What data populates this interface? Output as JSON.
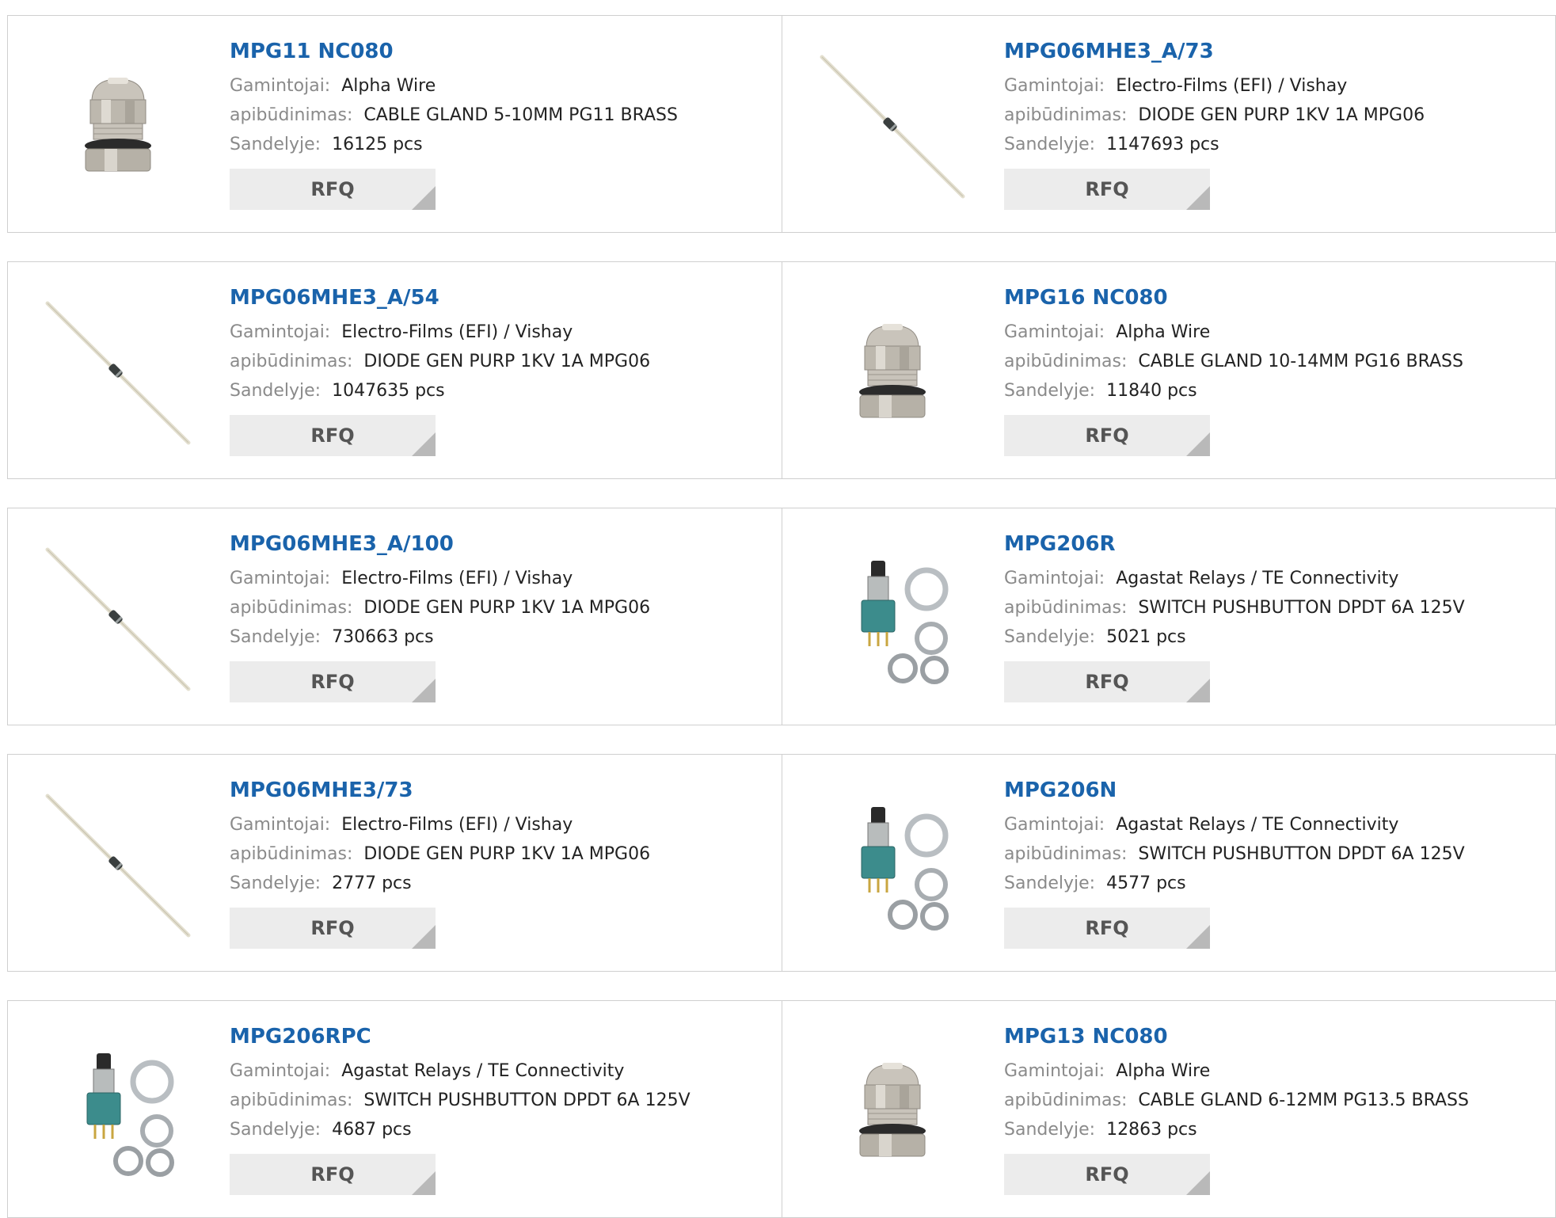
{
  "labels": {
    "manufacturer": "Gamintojai:",
    "description": "apibūdinimas:",
    "stock": "Sandelyje:",
    "rfq": "RFQ"
  },
  "colors": {
    "link": "#1a63ab",
    "label": "#8a8a8a",
    "button_bg": "#ececec",
    "border": "#cfcfcf"
  },
  "products": [
    {
      "name": "MPG11 NC080",
      "manufacturer": "Alpha Wire",
      "description": "CABLE GLAND 5-10MM PG11 BRASS",
      "stock": "16125 pcs",
      "image_icon": "cable-gland-icon"
    },
    {
      "name": "MPG06MHE3_A/73",
      "manufacturer": "Electro-Films (EFI) / Vishay",
      "description": "DIODE GEN PURP 1KV 1A MPG06",
      "stock": "1147693 pcs",
      "image_icon": "diode-icon"
    },
    {
      "name": "MPG06MHE3_A/54",
      "manufacturer": "Electro-Films (EFI) / Vishay",
      "description": "DIODE GEN PURP 1KV 1A MPG06",
      "stock": "1047635 pcs",
      "image_icon": "diode-icon"
    },
    {
      "name": "MPG16 NC080",
      "manufacturer": "Alpha Wire",
      "description": "CABLE GLAND 10-14MM PG16 BRASS",
      "stock": "11840 pcs",
      "image_icon": "cable-gland-icon"
    },
    {
      "name": "MPG06MHE3_A/100",
      "manufacturer": "Electro-Films (EFI) / Vishay",
      "description": "DIODE GEN PURP 1KV 1A MPG06",
      "stock": "730663 pcs",
      "image_icon": "diode-icon"
    },
    {
      "name": "MPG206R",
      "manufacturer": "Agastat Relays / TE Connectivity",
      "description": "SWITCH PUSHBUTTON DPDT 6A 125V",
      "stock": "5021 pcs",
      "image_icon": "pushbutton-switch-icon"
    },
    {
      "name": "MPG06MHE3/73",
      "manufacturer": "Electro-Films (EFI) / Vishay",
      "description": "DIODE GEN PURP 1KV 1A MPG06",
      "stock": "2777 pcs",
      "image_icon": "diode-icon"
    },
    {
      "name": "MPG206N",
      "manufacturer": "Agastat Relays / TE Connectivity",
      "description": "SWITCH PUSHBUTTON DPDT 6A 125V",
      "stock": "4577 pcs",
      "image_icon": "pushbutton-switch-icon"
    },
    {
      "name": "MPG206RPC",
      "manufacturer": "Agastat Relays / TE Connectivity",
      "description": "SWITCH PUSHBUTTON DPDT 6A 125V",
      "stock": "4687 pcs",
      "image_icon": "pushbutton-switch-icon"
    },
    {
      "name": "MPG13 NC080",
      "manufacturer": "Alpha Wire",
      "description": "CABLE GLAND 6-12MM PG13.5 BRASS",
      "stock": "12863 pcs",
      "image_icon": "cable-gland-icon"
    }
  ]
}
